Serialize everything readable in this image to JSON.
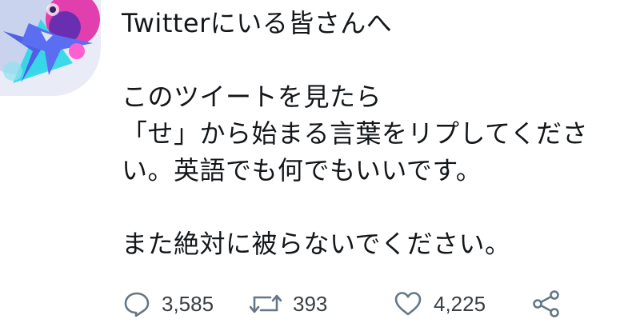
{
  "tweet": {
    "lines": [
      "Twitterにいる皆さんへ",
      "",
      "このツイートを見たら",
      "「せ」から始まる言葉をリプしてくださ",
      "い。英語でも何でもいいです。",
      "",
      "また絶対に被らないでください。"
    ]
  },
  "actions": {
    "reply": {
      "icon": "reply-icon",
      "count": "3,585"
    },
    "retweet": {
      "icon": "retweet-icon",
      "count": "393"
    },
    "like": {
      "icon": "heart-icon",
      "count": "4,225"
    },
    "share": {
      "icon": "share-icon"
    }
  },
  "colors": {
    "icon": "#657786",
    "text": "#14171a"
  }
}
